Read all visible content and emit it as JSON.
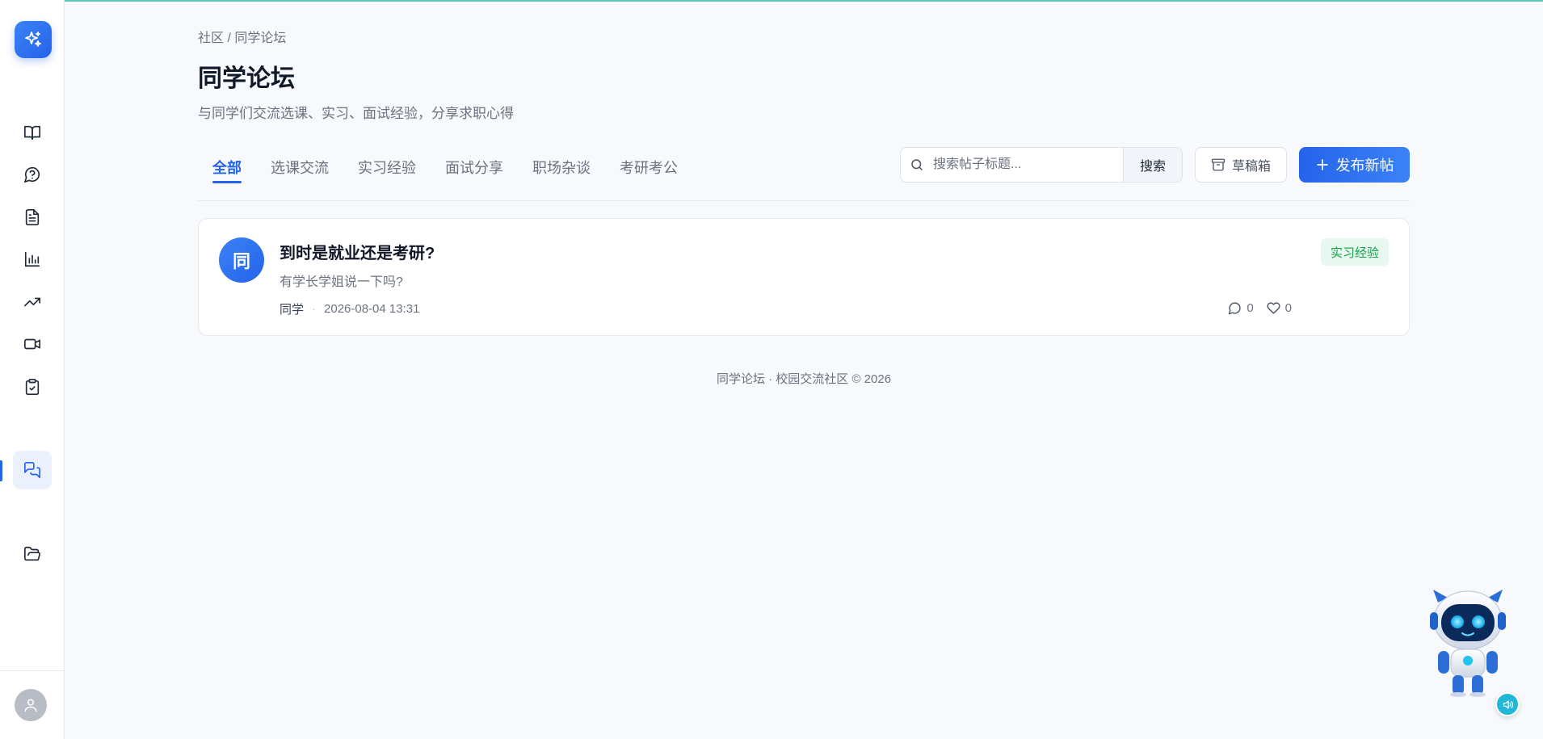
{
  "breadcrumb": {
    "root": "社区",
    "separator": "/",
    "current": "同学论坛"
  },
  "page": {
    "title": "同学论坛",
    "subtitle": "与同学们交流选课、实习、面试经验，分享求职心得"
  },
  "tabs": [
    {
      "label": "全部",
      "active": true
    },
    {
      "label": "选课交流",
      "active": false
    },
    {
      "label": "实习经验",
      "active": false
    },
    {
      "label": "面试分享",
      "active": false
    },
    {
      "label": "职场杂谈",
      "active": false
    },
    {
      "label": "考研考公",
      "active": false
    }
  ],
  "search": {
    "placeholder": "搜索帖子标题...",
    "value": "",
    "button_label": "搜索"
  },
  "actions": {
    "drafts_label": "草稿箱",
    "publish_label": "发布新帖"
  },
  "sidebar": {
    "items": [
      {
        "icon": "book-open-icon"
      },
      {
        "icon": "help-circle-icon"
      },
      {
        "icon": "document-icon"
      },
      {
        "icon": "bar-chart-icon"
      },
      {
        "icon": "trending-up-icon"
      },
      {
        "icon": "video-icon"
      },
      {
        "icon": "clipboard-check-icon"
      },
      {
        "icon": "messages-icon",
        "active": true
      },
      {
        "icon": "folder-open-icon"
      }
    ]
  },
  "posts": [
    {
      "avatar_text": "同",
      "title": "到时是就业还是考研?",
      "excerpt": "有学长学姐说一下吗?",
      "author": "同学",
      "meta_separator": "·",
      "time": "2026-08-04 13:31",
      "tag": "实习经验",
      "comments": "0",
      "likes": "0"
    }
  ],
  "footer": {
    "text": "同学论坛 · 校园交流社区 © 2026"
  },
  "colors": {
    "primary": "#2563eb",
    "tag_bg": "#e8f8f0",
    "tag_text": "#16a34a",
    "accent_teal": "#20b8d6"
  }
}
